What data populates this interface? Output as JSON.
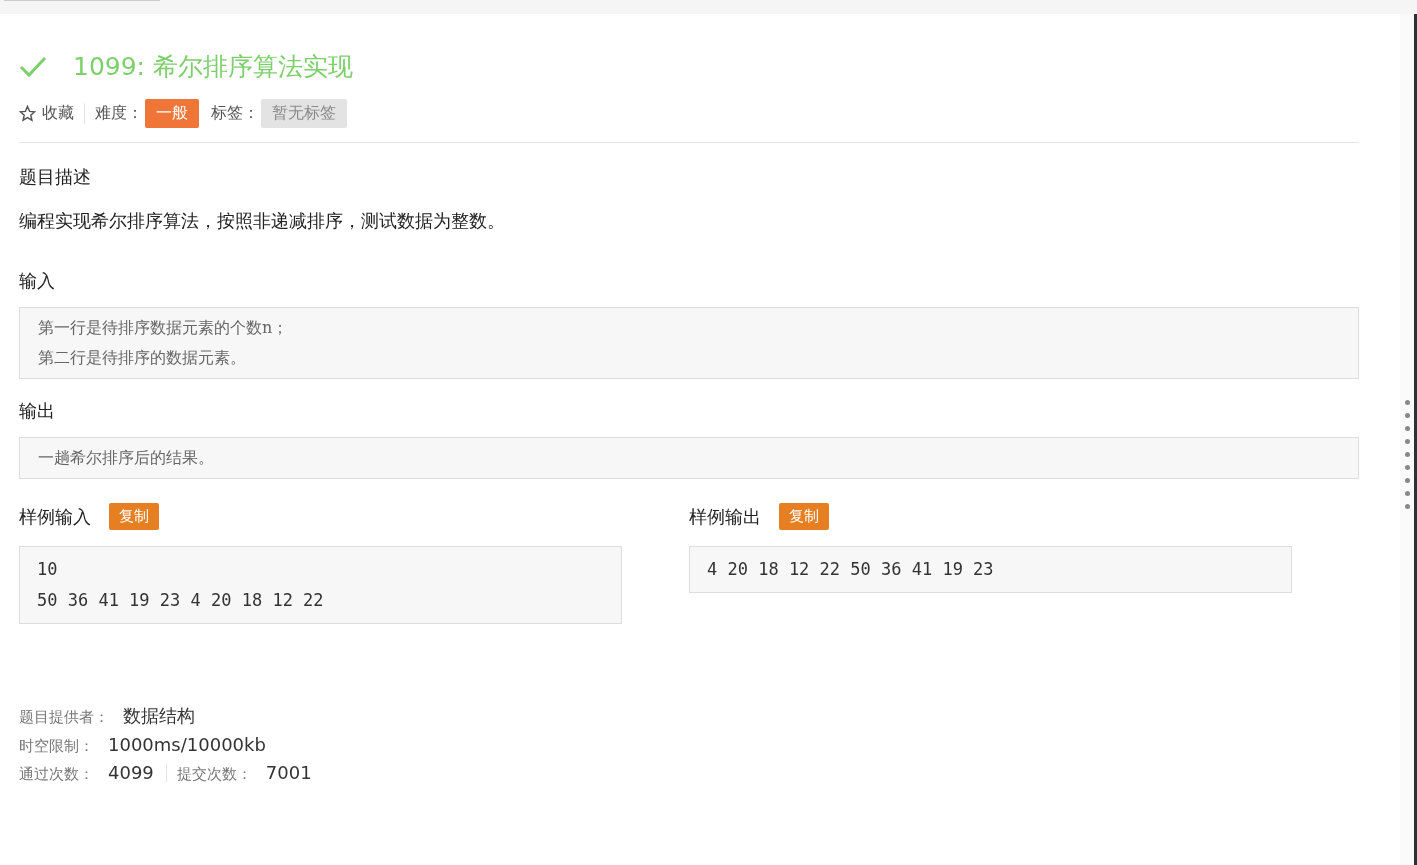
{
  "problem": {
    "solved": true,
    "title": "1099: 希尔排序算法实现"
  },
  "meta": {
    "favorite": {
      "label": "收藏",
      "starred": false
    },
    "difficulty_label": "难度：",
    "difficulty": "一般",
    "tags_label": "标签：",
    "tags_placeholder": "暂无标签"
  },
  "description": {
    "heading": "题目描述",
    "text": "编程实现希尔排序算法，按照非递减排序，测试数据为整数。"
  },
  "input": {
    "heading": "输入",
    "lines": [
      "第一行是待排序数据元素的个数n；",
      "第二行是待排序的数据元素。"
    ]
  },
  "output": {
    "heading": "输出",
    "lines": [
      "一趟希尔排序后的结果。"
    ]
  },
  "samples": [
    {
      "heading": "样例输入",
      "copy": "复制",
      "lines": [
        "10",
        "50 36 41 19 23 4 20 18 12 22"
      ]
    },
    {
      "heading": "样例输出",
      "copy": "复制",
      "lines": [
        "4 20 18 12 22 50 36 41 19 23"
      ]
    }
  ],
  "info": [
    {
      "label": "题目提供者：",
      "value": "数据结构"
    },
    {
      "label": "时空限制：",
      "value": "1000ms/10000kb"
    }
  ],
  "stats": [
    {
      "label": "通过次数：",
      "value": "4099"
    },
    {
      "label": "提交次数：",
      "value": "7001"
    }
  ]
}
